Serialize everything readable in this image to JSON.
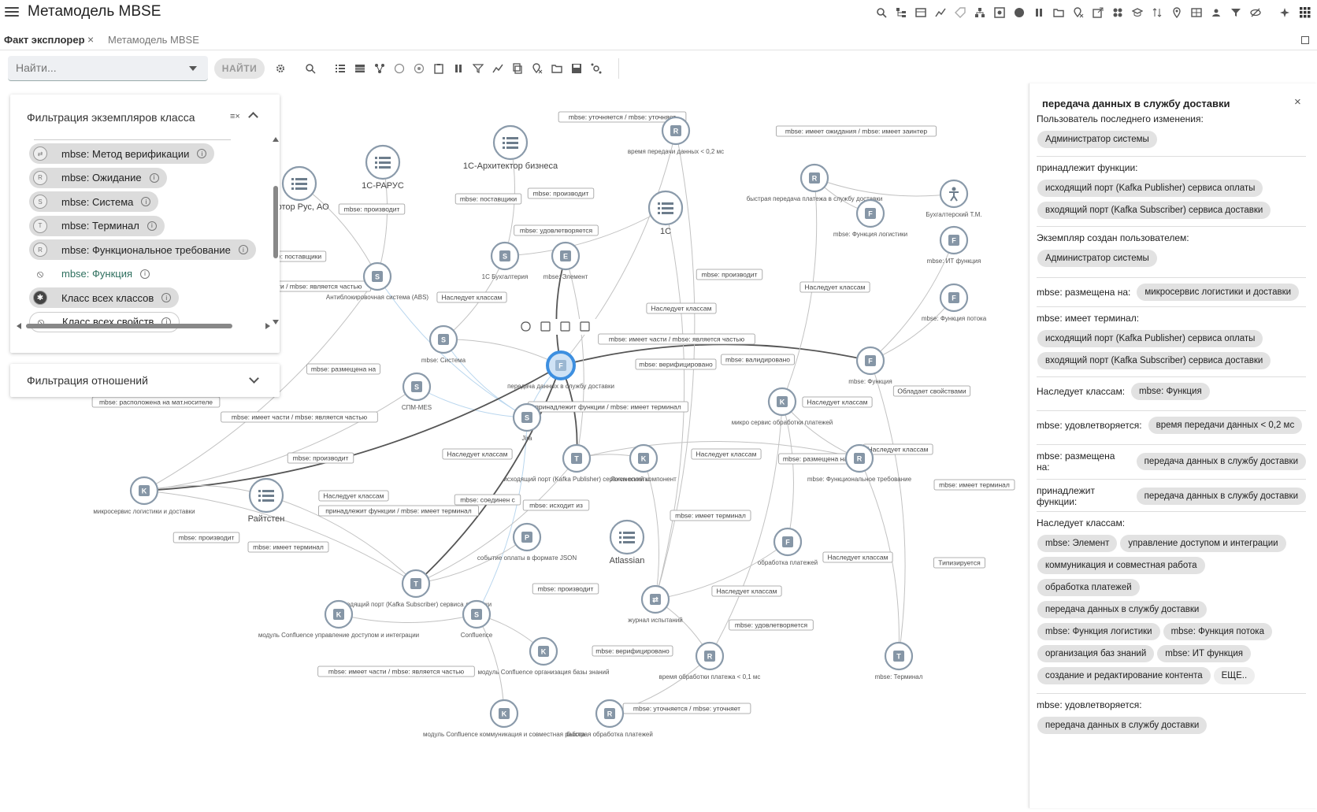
{
  "app": {
    "title": "Метамодель MBSE"
  },
  "tabs": [
    {
      "label": "Факт эксплорер"
    },
    {
      "label": "Метамодель MBSE"
    }
  ],
  "toolbar": {
    "search_placeholder": "Найти...",
    "find_label": "НАЙТИ"
  },
  "filter_panel": {
    "title": "Фильтрация экземпляров класса",
    "chips": [
      {
        "label": "mbse: Метод верификации",
        "style": "filled",
        "icon": "arrows-icon"
      },
      {
        "label": "mbse: Ожидание",
        "style": "filled",
        "icon": "r-icon"
      },
      {
        "label": "mbse: Система",
        "style": "filled",
        "icon": "s-icon"
      },
      {
        "label": "mbse: Терминал",
        "style": "filled",
        "icon": "t-icon"
      },
      {
        "label": "mbse: Функциональное требование",
        "style": "filled",
        "icon": "r-icon"
      },
      {
        "label": "mbse: Функция",
        "style": "plain",
        "icon": "eye-off-icon"
      },
      {
        "label": "Класс всех классов",
        "style": "filled",
        "icon": "asterisk-icon"
      },
      {
        "label": "Класс всех свойств",
        "style": "outlined",
        "icon": "eye-off-icon"
      }
    ]
  },
  "relation_panel": {
    "title": "Фильтрация отношений"
  },
  "graph": {
    "nodes": [
      {
        "id": "n1",
        "label": "1С-Архитектор бизнеса",
        "kind": "list"
      },
      {
        "id": "n2",
        "label": "1С-РАРУС",
        "kind": "list"
      },
      {
        "id": "n3",
        "label": "Мотор Рус, АО",
        "kind": "list"
      },
      {
        "id": "n4",
        "label": "1С",
        "kind": "list"
      },
      {
        "id": "n5",
        "label": "Райтстен",
        "kind": "list"
      },
      {
        "id": "n6",
        "label": "Atlassian",
        "kind": "list"
      },
      {
        "id": "n7",
        "label": "время передачи данных < 0,2 мс",
        "kind": "R"
      },
      {
        "id": "n8",
        "label": "быстрая передача платежа в службу доставки",
        "kind": "R"
      },
      {
        "id": "n9",
        "label": "Бухгалтерский Т.М.",
        "kind": "person"
      },
      {
        "id": "n10",
        "label": "mbse: Функция логистики",
        "kind": "F"
      },
      {
        "id": "n11",
        "label": "mbse: ИТ функция",
        "kind": "F"
      },
      {
        "id": "n12",
        "label": "mbse: Функция потока",
        "kind": "F"
      },
      {
        "id": "n13",
        "label": "mbse: Функция",
        "kind": "F"
      },
      {
        "id": "n14",
        "label": "1С Бухгалтерия",
        "kind": "S"
      },
      {
        "id": "n15",
        "label": "mbse: Элемент",
        "kind": "E"
      },
      {
        "id": "n16",
        "label": "Антиблокировочная система (ABS)",
        "kind": "S"
      },
      {
        "id": "n17",
        "label": "mbse: Система",
        "kind": "S"
      },
      {
        "id": "n18",
        "label": "СПМ-MES",
        "kind": "S"
      },
      {
        "id": "n19",
        "label": "Jira",
        "kind": "S"
      },
      {
        "id": "n20",
        "label": "передача данных в службу доставки",
        "kind": "F"
      },
      {
        "id": "n21",
        "label": "микро сервис обработки платежей",
        "kind": "K"
      },
      {
        "id": "n22",
        "label": "исходящий порт (Kafka Publisher) сервиса оплаты",
        "kind": "T"
      },
      {
        "id": "n23",
        "label": "Логический компонент",
        "kind": "K"
      },
      {
        "id": "n24",
        "label": "mbse: Функциональное требование",
        "kind": "R"
      },
      {
        "id": "n25",
        "label": "микросервис логистики и доставки",
        "kind": "K"
      },
      {
        "id": "n26",
        "label": "событие оплаты в формате JSON",
        "kind": "P"
      },
      {
        "id": "n27",
        "label": "обработка платежей",
        "kind": "F"
      },
      {
        "id": "n28",
        "label": "входящий порт (Kafka Subscriber) сервиса доставки",
        "kind": "T"
      },
      {
        "id": "n29",
        "label": "модуль Confluence управление доступом и интеграции",
        "kind": "K"
      },
      {
        "id": "n30",
        "label": "Confluence",
        "kind": "S"
      },
      {
        "id": "n31",
        "label": "журнал испытаний",
        "kind": "arrows"
      },
      {
        "id": "n32",
        "label": "модуль Confluence организация базы знаний",
        "kind": "K"
      },
      {
        "id": "n33",
        "label": "время обработки платежа < 0,1 мс",
        "kind": "R"
      },
      {
        "id": "n34",
        "label": "mbse: Терминал",
        "kind": "T"
      },
      {
        "id": "n35",
        "label": "модуль Confluence коммуникация и совместная работа",
        "kind": "K"
      },
      {
        "id": "n36",
        "label": "быстрая обработка платежей",
        "kind": "R"
      }
    ],
    "edge_labels": [
      "mbse: уточняется / mbse: уточняет",
      "mbse: имеет ожидания / mbse: имеет заинтересованную сторону",
      "mbse: производит",
      "mbse: поставщики",
      "mbse: производит",
      "mbse: удовлетворяется",
      "mbse: поставщики",
      "части / mbse: является частью",
      "Наследует классам",
      "mbse: производит",
      "Наследует классам",
      "Наследует классам",
      "mbse: имеет части / mbse: является частью",
      "mbse: верифицировано",
      "mbse: валидировано",
      "Обладает свойствами",
      "mbse: размещена на",
      "mbse: расположена на мат.носителе",
      "mbse: имеет части / mbse: является частью",
      "принадлежит функции / mbse: имеет терминал",
      "Наследует классам",
      "Наследует классам",
      "mbse: производит",
      "Наследует классам",
      "mbse: размещена на",
      "Наследует классам",
      "Наследует классам",
      "mbse: имеет терминал",
      "mbse: соединен с",
      "принадлежит функции / mbse: имеет терминал",
      "mbse: исходит из",
      "mbse: имеет терминал",
      "mbse: производит",
      "mbse: имеет терминал",
      "Наследует классам",
      "Типизируется",
      "mbse: производит",
      "Наследует классам",
      "mbse: удовлетворяется",
      "mbse: верифицировано",
      "mbse: имеет части / mbse: является частью",
      "mbse: уточняется / mbse: уточняет"
    ]
  },
  "details": {
    "title": "передача данных в службу доставки",
    "props": [
      {
        "label": "Пользователь последнего изменения:",
        "values": [
          "Администратор системы"
        ],
        "inline": false
      },
      {
        "label": "принадлежит функции:",
        "values": [
          "исходящий порт (Kafka Publisher) сервиса оплаты",
          "входящий порт (Kafka Subscriber) сервиса доставки"
        ],
        "inline": false
      },
      {
        "label": "Экземпляр создан пользователем:",
        "values": [
          "Администратор системы"
        ],
        "inline": false
      },
      {
        "label": "mbse: размещена на:",
        "values": [
          "микросервис логистики и доставки"
        ],
        "inline": true
      },
      {
        "label": "mbse: имеет терминал:",
        "values": [
          "исходящий порт (Kafka Publisher) сервиса оплаты",
          "входящий порт (Kafka Subscriber) сервиса доставки"
        ],
        "inline": false
      },
      {
        "label": "Наследует классам:",
        "values": [
          "mbse: Функция"
        ],
        "inline": true
      },
      {
        "label": "mbse: удовлетворяется:",
        "values": [
          "время передачи данных < 0,2 мс"
        ],
        "inline": true
      },
      {
        "label": "mbse: размещена на:",
        "values": [
          "передача данных в службу доставки"
        ],
        "inline": true
      },
      {
        "label": "принадлежит функции:",
        "values": [
          "передача данных в службу доставки"
        ],
        "inline": true
      },
      {
        "label": "Наследует классам:",
        "values": [
          "mbse: Элемент",
          "управление доступом и интеграции",
          "коммуникация и совместная работа",
          "обработка платежей",
          "передача данных в службу доставки",
          "mbse: Функция логистики",
          "mbse: Функция потока",
          "организация баз знаний",
          "mbse: ИТ функция",
          "создание и редактирование контента",
          "ЕЩЕ.."
        ],
        "inline": false
      },
      {
        "label": "mbse: удовлетворяется:",
        "values": [
          "передача данных в службу доставки"
        ],
        "inline": false
      }
    ]
  }
}
